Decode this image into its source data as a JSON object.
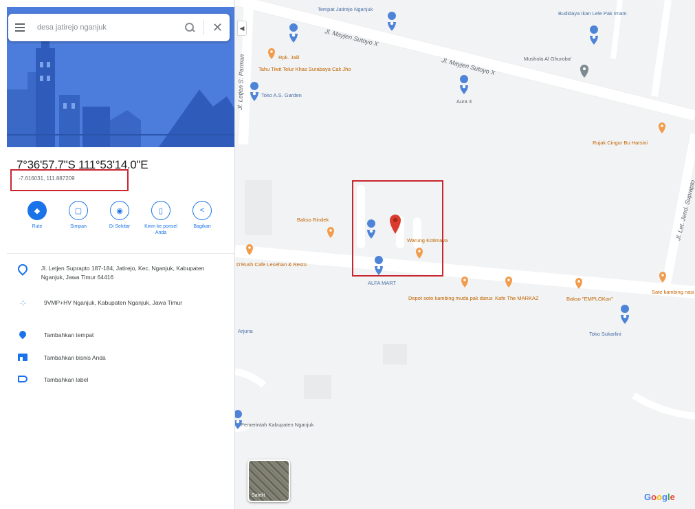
{
  "search": {
    "query": "desa jatirejo nganjuk",
    "menu_icon": "hamburger-menu-icon",
    "search_icon": "magnifier-icon",
    "close_icon": "close-x-icon"
  },
  "place": {
    "coordinates_dms": "7°36'57.7\"S 111°53'14.0\"E",
    "coordinates_decimal": "-7.616031, 111.887209"
  },
  "actions": [
    {
      "label": "Rute",
      "icon": "directions-icon",
      "primary": true
    },
    {
      "label": "Simpan",
      "icon": "bookmark-icon",
      "primary": false
    },
    {
      "label": "Di Sekitar",
      "icon": "nearby-icon",
      "primary": false
    },
    {
      "label": "Kirim ke ponsel Anda",
      "icon": "send-to-phone-icon",
      "primary": false
    },
    {
      "label": "Bagikan",
      "icon": "share-icon",
      "primary": false
    }
  ],
  "info": {
    "address": "Jl. Letjen Suprapto 187-184, Jatirejo, Kec. Nganjuk, Kabupaten Nganjuk, Jawa Timur 64416",
    "plus_code": "9VMP+HV Nganjuk, Kabupaten Nganjuk, Jawa Timur",
    "add_place": "Tambahkan tempat",
    "add_business": "Tambahkan bisnis Anda",
    "add_label": "Tambahkan label"
  },
  "map": {
    "roads": {
      "mayjen_upper": "Jl. Mayjen Sutoyo X",
      "mayjen_lower": "Jl. Mayjen Sutoyo X",
      "letjen_panjaitan": "Jl. Letjen S. Parman",
      "letjen_suprapto": "Jl. Let. Jend. Suprapto"
    },
    "pois": {
      "jatirejo_top": "Tempat Jatirejo Nganjuk",
      "budidaya": "Budidaya Ikan Lele Pak Imam",
      "rpk_jalil": "Rpk. Jalil",
      "tahu_tiwit": "Tahu Tiwit Telur Khas Surabaya Cak Jho",
      "toko_as": "Toko A.S. Garden",
      "aura3": "Aura 3",
      "mushola": "Mushola Al Ghuroba'",
      "rujak": "Rujak Cingur Bu Harsini",
      "bakso_rindek": "Bakso Rindek",
      "warung_kotimaya": "Warung Kotimaya",
      "drush": "D'Rush Cafe Lesehan & Resto",
      "alfamart": "ALFA MART",
      "depot_soto": "Depot soto kambing muda pak darus",
      "kafe_markaz": "Kafe The MARKAZ",
      "bakso_emplokan": "Bakso \"EMPLOKan\"",
      "sate": "Sate kambing nasi becek pi",
      "toko_sukarlini": "Toko Sukarlini",
      "pemerintah": "Pemerintah Kabupaten Nganjuk",
      "arjuna": "Arjuna"
    },
    "satellite_label": "Satelit",
    "logo": "Google",
    "colors": {
      "road": "#ffffff",
      "background": "#f1f3f4",
      "pin_red": "#db3b2f",
      "poi_orange": "#f29b4b",
      "poi_blue": "#4e84d8",
      "highlight": "#c8262f"
    }
  }
}
